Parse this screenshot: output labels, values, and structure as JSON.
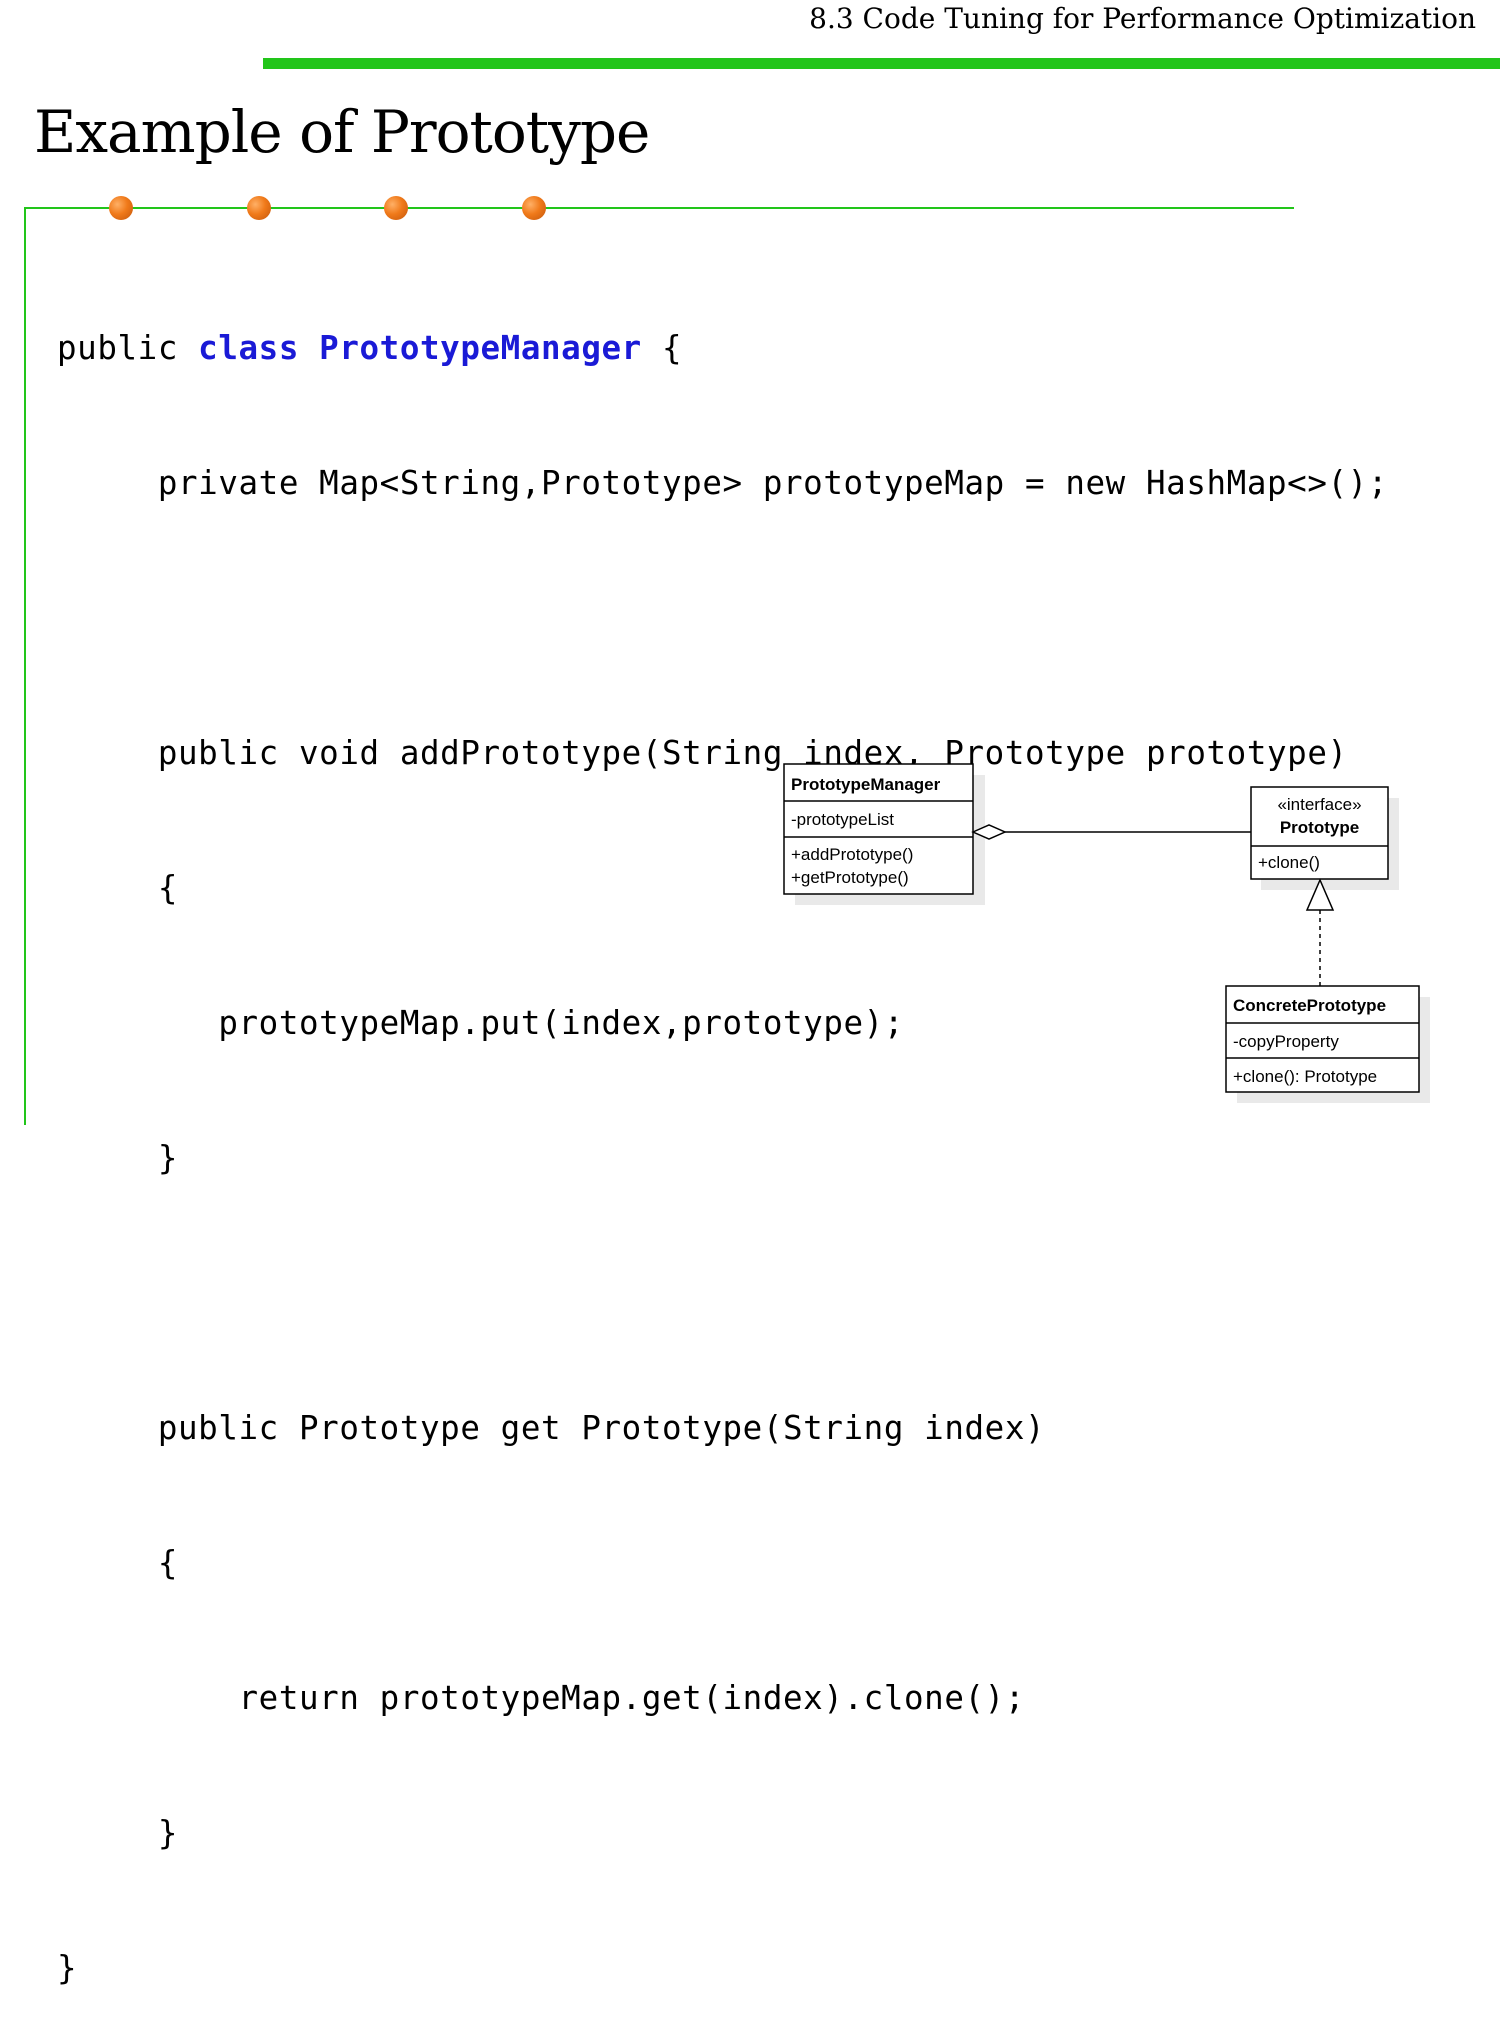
{
  "header": {
    "section_title": "8.3 Code Tuning for Performance Optimization"
  },
  "slide": {
    "title": "Example of Prototype"
  },
  "code": {
    "l1_prefix": "public ",
    "l1_kw": "class PrototypeManager",
    "l1_suffix": " {",
    "l2": "     private Map<String,Prototype> prototypeMap = new HashMap<>();",
    "l3": "",
    "l4": "     public void addPrototype(String index, Prototype prototype)",
    "l5": "     {",
    "l6": "        prototypeMap.put(index,prototype);",
    "l7": "     }",
    "l8": "",
    "l9": "     public Prototype get Prototype(String index)",
    "l10": "     {",
    "l11": "         return prototypeMap.get(index).clone();",
    "l12": "     }",
    "l13": "}"
  },
  "uml": {
    "manager": {
      "name": "PrototypeManager",
      "attribute": "-prototypeList",
      "method1": "+addPrototype()",
      "method2": "+getPrototype()"
    },
    "prototype": {
      "stereotype": "«interface»",
      "name": "Prototype",
      "method": "+clone()"
    },
    "concrete": {
      "name": "ConcretePrototype",
      "attribute": "-copyProperty",
      "method": "+clone(): Prototype"
    }
  },
  "colors": {
    "accent_green": "#22c51a",
    "keyword_blue": "#1a1ad6",
    "bullet_orange": "#f07a1a"
  }
}
